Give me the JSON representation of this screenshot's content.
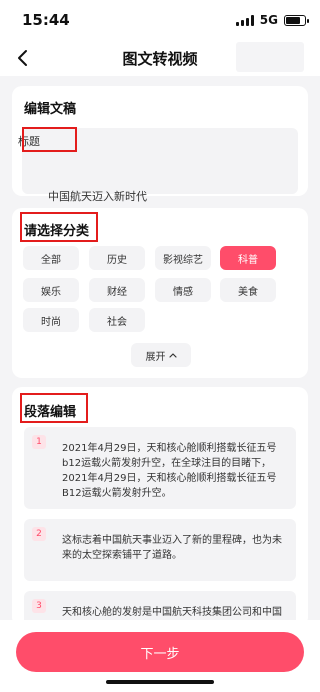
{
  "status_bar": {
    "time": "15:44",
    "network": "5G",
    "battery_level": 0.8
  },
  "nav": {
    "title": "图文转视频"
  },
  "editor_card": {
    "section_title": "编辑文稿",
    "title_label": "标题",
    "content": "中国航天迈入新时代"
  },
  "category_card": {
    "section_title": "请选择分类",
    "categories": [
      "全部",
      "历史",
      "影视综艺",
      "科普",
      "娱乐",
      "财经",
      "情感",
      "美食",
      "时尚",
      "社会"
    ],
    "selected": "科普",
    "expand_label": "展开"
  },
  "paragraph_card": {
    "section_title": "段落编辑",
    "paragraphs": [
      {
        "number": "1",
        "text": "2021年4月29日，天和核心舱顺利搭载长征五号b12运载火箭发射升空，在全球注目的目睹下，2021年4月29日，天和核心舱顺利搭载长征五号B12运载火箭发射升空。"
      },
      {
        "number": "2",
        "text": "这标志着中国航天事业迈入了新的里程碑，也为未来的太空探索铺平了道路。"
      },
      {
        "number": "3",
        "text": "天和核心舱的发射是中国航天科技集团公司和中国"
      }
    ]
  },
  "bottom": {
    "next_label": "下一步"
  },
  "colors": {
    "accent": "#ff4d6a",
    "highlight_box": "#e31c1c"
  },
  "icons": {
    "back": "chevron-left-icon",
    "expand": "chevron-up-icon"
  }
}
